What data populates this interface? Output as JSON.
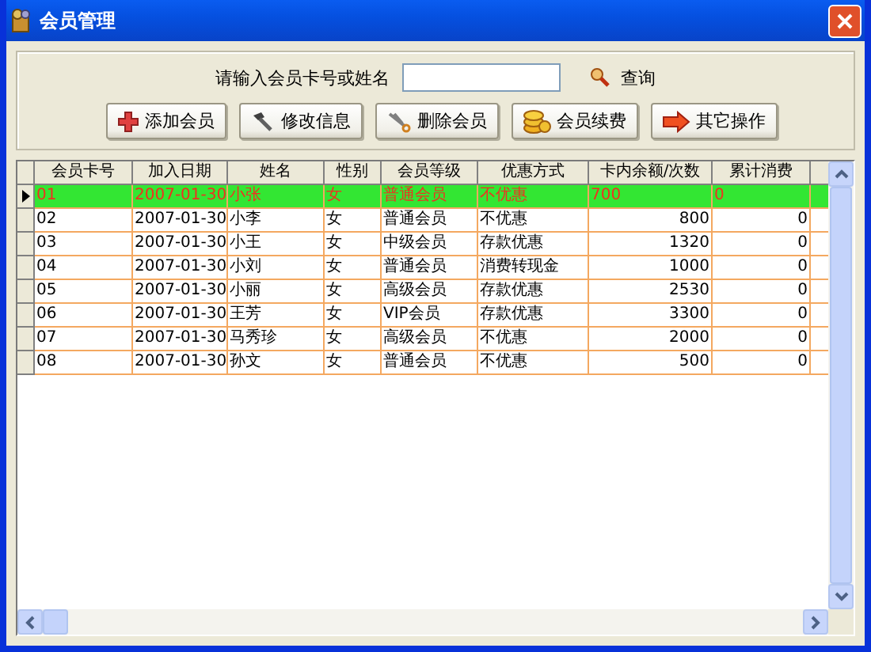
{
  "window": {
    "title": "会员管理"
  },
  "search": {
    "label": "请输入会员卡号或姓名",
    "button": "查询"
  },
  "buttons": [
    {
      "label": "添加会员",
      "kind": "add"
    },
    {
      "label": "修改信息",
      "kind": "edit"
    },
    {
      "label": "删除会员",
      "kind": "delete"
    },
    {
      "label": "会员续费",
      "kind": "renew"
    },
    {
      "label": "其它操作",
      "kind": "other"
    }
  ],
  "table": {
    "columns": [
      "会员卡号",
      "加入日期",
      "姓名",
      "性别",
      "会员等级",
      "优惠方式",
      "卡内余额/次数",
      "累计消费"
    ],
    "rows": [
      {
        "selected": true,
        "cells": [
          "01",
          "2007-01-30",
          "小张",
          "女",
          "普通会员",
          "不优惠",
          "700",
          "0"
        ]
      },
      {
        "selected": false,
        "cells": [
          "02",
          "2007-01-30",
          "小李",
          "女",
          "普通会员",
          "不优惠",
          "800",
          "0"
        ]
      },
      {
        "selected": false,
        "cells": [
          "03",
          "2007-01-30",
          "小王",
          "女",
          "中级会员",
          "存款优惠",
          "1320",
          "0"
        ]
      },
      {
        "selected": false,
        "cells": [
          "04",
          "2007-01-30",
          "小刘",
          "女",
          "普通会员",
          "消费转现金",
          "1000",
          "0"
        ]
      },
      {
        "selected": false,
        "cells": [
          "05",
          "2007-01-30",
          "小丽",
          "女",
          "高级会员",
          "存款优惠",
          "2530",
          "0"
        ]
      },
      {
        "selected": false,
        "cells": [
          "06",
          "2007-01-30",
          "王芳",
          "女",
          "VIP会员",
          "存款优惠",
          "3300",
          "0"
        ]
      },
      {
        "selected": false,
        "cells": [
          "07",
          "2007-01-30",
          "马秀珍",
          "女",
          "高级会员",
          "不优惠",
          "2000",
          "0"
        ]
      },
      {
        "selected": false,
        "cells": [
          "08",
          "2007-01-30",
          "孙文",
          "女",
          "普通会员",
          "不优惠",
          "500",
          "0"
        ]
      }
    ]
  }
}
